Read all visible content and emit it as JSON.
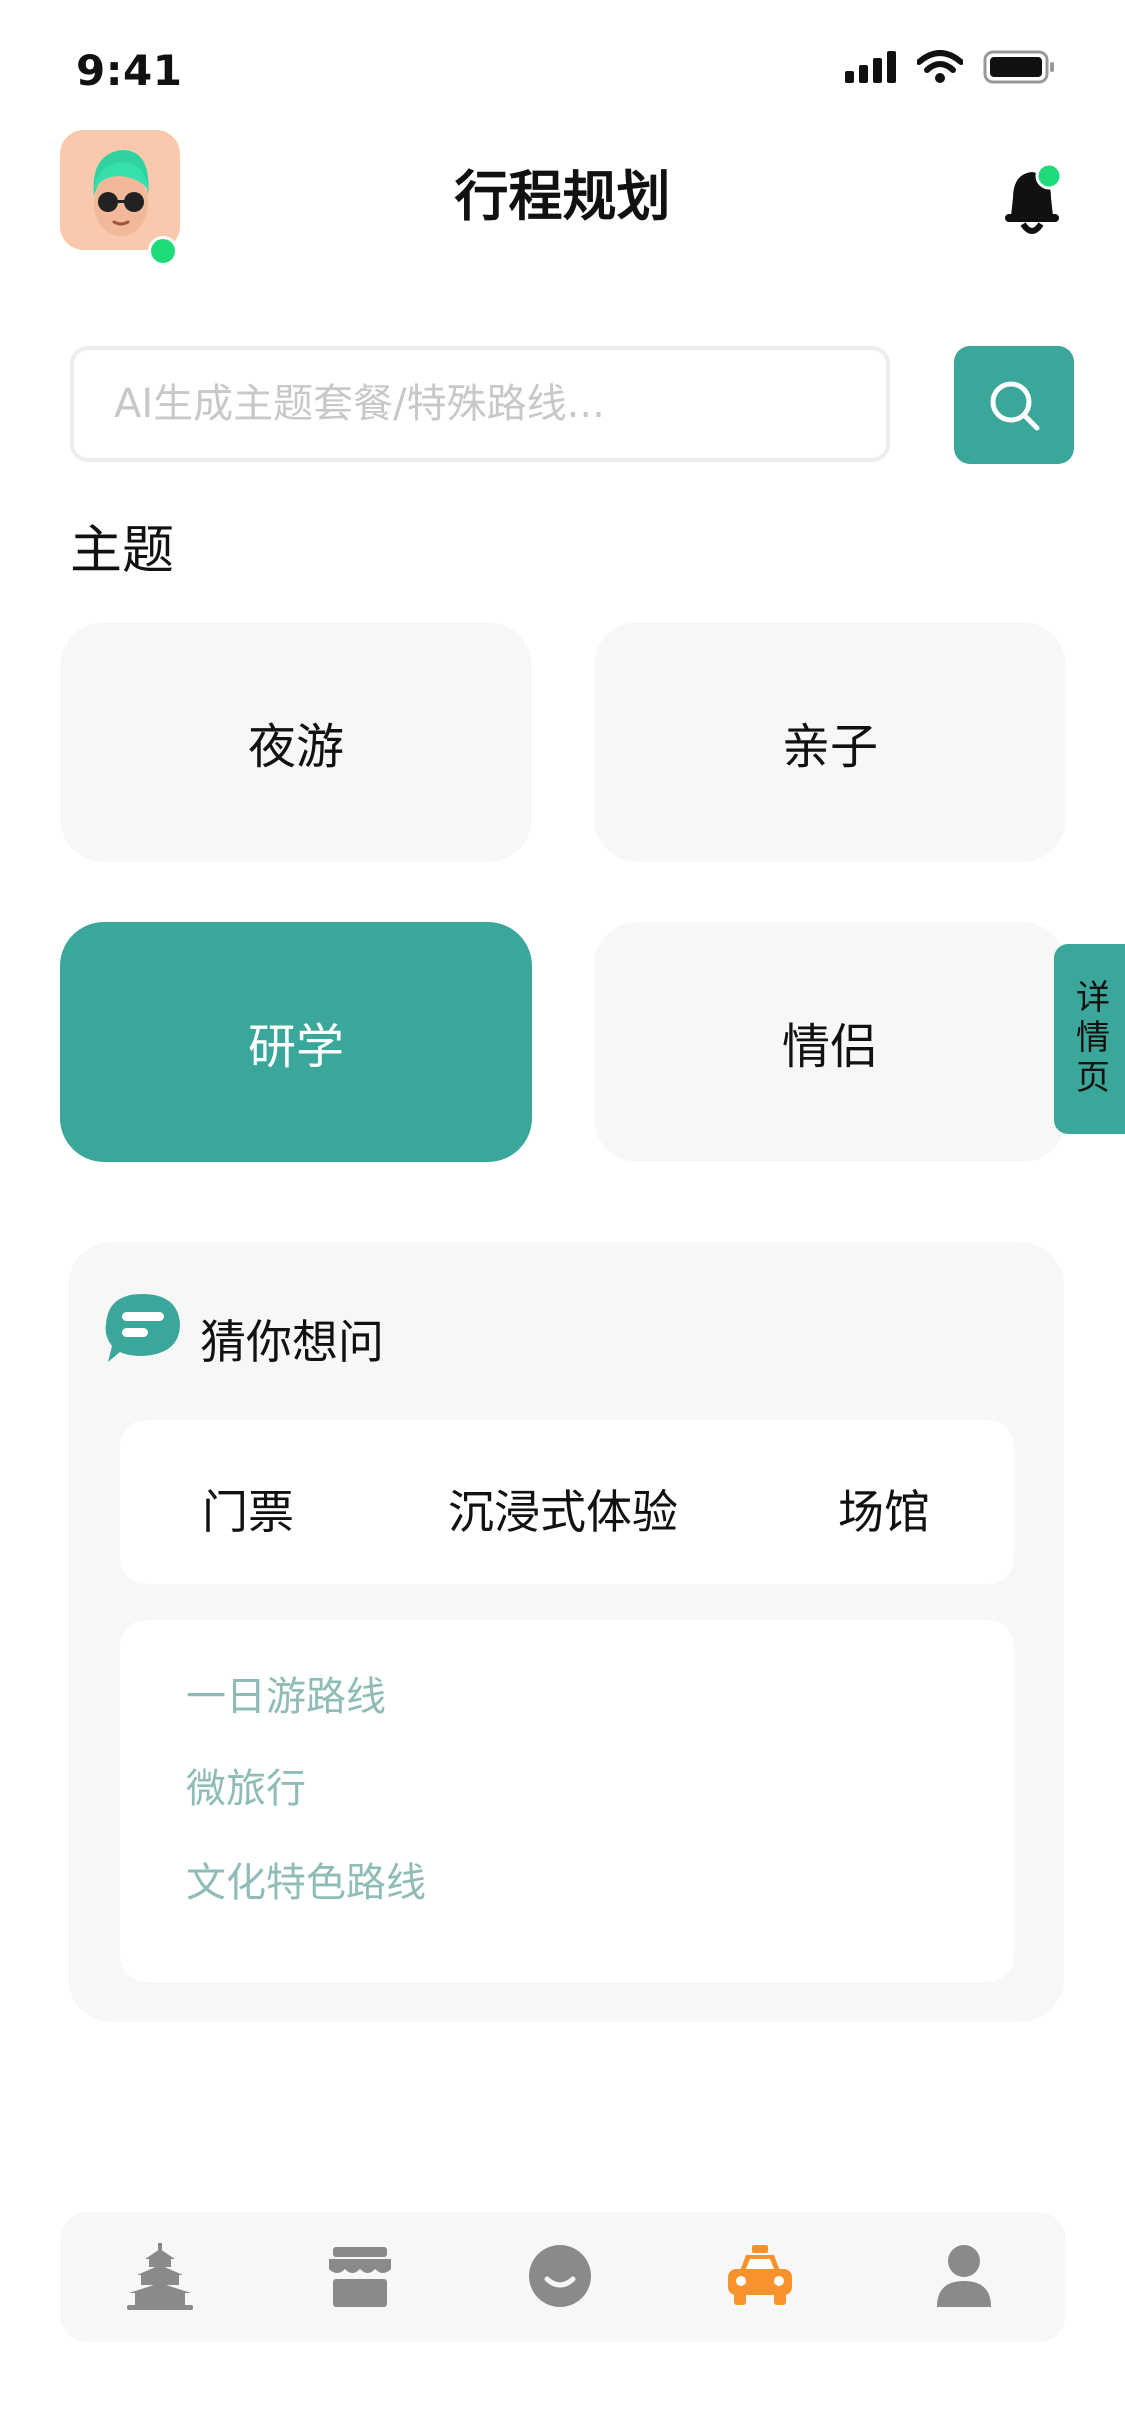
{
  "status_bar": {
    "time": "9:41"
  },
  "header": {
    "title": "行程规划"
  },
  "search": {
    "placeholder": "AI生成主题套餐/特殊路线..."
  },
  "themes": {
    "section_title": "主题",
    "items": [
      {
        "label": "夜游",
        "selected": false
      },
      {
        "label": "亲子",
        "selected": false
      },
      {
        "label": "研学",
        "selected": true
      },
      {
        "label": "情侣",
        "selected": false
      }
    ]
  },
  "side_tab": {
    "label": "详情页"
  },
  "guess": {
    "title": "猜你想问",
    "chips": [
      "门票",
      "沉浸式体验",
      "场馆"
    ],
    "suggestions": [
      "一日游路线",
      "微旅行",
      "文化特色路线"
    ]
  },
  "tab_bar": {
    "items": [
      {
        "icon": "temple-icon",
        "active": false
      },
      {
        "icon": "store-icon",
        "active": false
      },
      {
        "icon": "smile-icon",
        "active": false
      },
      {
        "icon": "taxi-icon",
        "active": true
      },
      {
        "icon": "user-icon",
        "active": false
      }
    ]
  },
  "colors": {
    "accent": "#3aa79a",
    "active_tab": "#f7922d",
    "online": "#1fdc7a"
  }
}
